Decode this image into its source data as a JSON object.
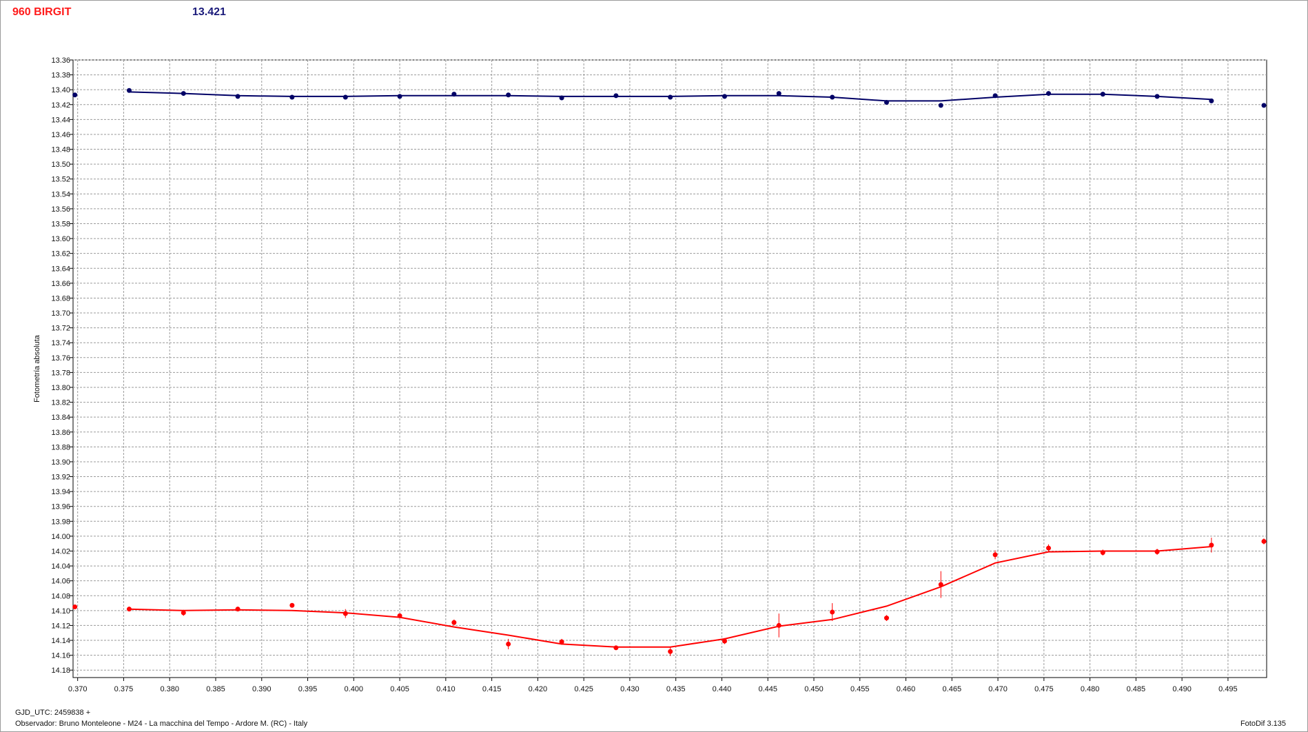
{
  "header": {
    "object_name": "960 BIRGIT",
    "comparison_mag": "13.421"
  },
  "footer": {
    "gjd": "GJD_UTC: 2459838 +",
    "observer": "Observador: Bruno Monteleone - M24 - La macchina del Tempo - Ardore M. (RC) - Italy",
    "software": "FotoDif 3.135"
  },
  "colors": {
    "series_blue": "#000066",
    "series_red": "#ff0000",
    "grid": "#9a9a9a"
  },
  "chart_data": {
    "type": "scatter",
    "ylabel": "Fotometría absoluta",
    "xlabel": "",
    "xlim": [
      0.3695,
      0.4992
    ],
    "ylim": [
      13.36,
      14.19
    ],
    "y_inverted": true,
    "grid": true,
    "x_ticks": [
      "0.370",
      "0.375",
      "0.380",
      "0.385",
      "0.390",
      "0.395",
      "0.400",
      "0.405",
      "0.410",
      "0.415",
      "0.420",
      "0.425",
      "0.430",
      "0.435",
      "0.440",
      "0.445",
      "0.450",
      "0.455",
      "0.460",
      "0.465",
      "0.470",
      "0.475",
      "0.480",
      "0.485",
      "0.490",
      "0.495"
    ],
    "y_ticks": [
      "13.36",
      "13.38",
      "13.40",
      "13.42",
      "13.44",
      "13.46",
      "13.48",
      "13.50",
      "13.52",
      "13.54",
      "13.56",
      "13.58",
      "13.60",
      "13.62",
      "13.64",
      "13.66",
      "13.68",
      "13.70",
      "13.72",
      "13.74",
      "13.76",
      "13.78",
      "13.80",
      "13.82",
      "13.84",
      "13.86",
      "13.88",
      "13.90",
      "13.92",
      "13.94",
      "13.96",
      "13.98",
      "14.00",
      "14.02",
      "14.04",
      "14.06",
      "14.08",
      "14.10",
      "14.12",
      "14.14",
      "14.16",
      "14.18"
    ],
    "series": [
      {
        "color": "#000066",
        "x": [
          0.3697,
          0.3756,
          0.3815,
          0.3874,
          0.3933,
          0.3991,
          0.405,
          0.4109,
          0.4168,
          0.4226,
          0.4285,
          0.4344,
          0.4403,
          0.4462,
          0.452,
          0.4579,
          0.4638,
          0.4697,
          0.4755,
          0.4814,
          0.4873,
          0.4932,
          0.4989
        ],
        "y": [
          13.407,
          13.401,
          13.405,
          13.409,
          13.41,
          13.41,
          13.409,
          13.406,
          13.407,
          13.411,
          13.408,
          13.41,
          13.409,
          13.405,
          13.41,
          13.417,
          13.421,
          13.408,
          13.405,
          13.406,
          13.409,
          13.415,
          13.421
        ],
        "fit_x": [
          0.3756,
          0.3815,
          0.3874,
          0.3933,
          0.3991,
          0.405,
          0.4109,
          0.4168,
          0.4226,
          0.4285,
          0.4344,
          0.4403,
          0.4462,
          0.452,
          0.4579,
          0.4638,
          0.4697,
          0.4755,
          0.4814,
          0.4873,
          0.4932
        ],
        "fit_y": [
          13.403,
          13.405,
          13.408,
          13.409,
          13.409,
          13.408,
          13.408,
          13.408,
          13.409,
          13.409,
          13.409,
          13.408,
          13.408,
          13.41,
          13.415,
          13.415,
          13.41,
          13.406,
          13.406,
          13.409,
          13.413
        ]
      },
      {
        "color": "#ff0000",
        "x": [
          0.3697,
          0.3756,
          0.3815,
          0.3874,
          0.3933,
          0.3991,
          0.405,
          0.4109,
          0.4168,
          0.4226,
          0.4285,
          0.4344,
          0.4403,
          0.4462,
          0.452,
          0.4579,
          0.4638,
          0.4697,
          0.4755,
          0.4814,
          0.4873,
          0.4932,
          0.4989
        ],
        "y": [
          14.095,
          14.098,
          14.103,
          14.098,
          14.093,
          14.104,
          14.107,
          14.116,
          14.145,
          14.142,
          14.15,
          14.155,
          14.141,
          14.12,
          14.102,
          14.11,
          14.065,
          14.025,
          14.016,
          14.022,
          14.021,
          14.012,
          14.007
        ],
        "err": [
          0.003,
          0.003,
          0.004,
          0.003,
          0.003,
          0.006,
          0.003,
          0.004,
          0.007,
          0.004,
          0.003,
          0.006,
          0.004,
          0.016,
          0.012,
          0.004,
          0.018,
          0.006,
          0.005,
          0.004,
          0.004,
          0.01,
          0.004
        ],
        "fit_x": [
          0.3756,
          0.3815,
          0.3874,
          0.3933,
          0.3991,
          0.405,
          0.4109,
          0.4168,
          0.4226,
          0.4285,
          0.4344,
          0.4403,
          0.4462,
          0.452,
          0.4579,
          0.4638,
          0.4697,
          0.4755,
          0.4814,
          0.4873,
          0.4932
        ],
        "fit_y": [
          14.098,
          14.1,
          14.099,
          14.1,
          14.103,
          14.109,
          14.122,
          14.133,
          14.145,
          14.149,
          14.149,
          14.138,
          14.121,
          14.112,
          14.094,
          14.068,
          14.036,
          14.021,
          14.02,
          14.02,
          14.014
        ]
      }
    ]
  }
}
